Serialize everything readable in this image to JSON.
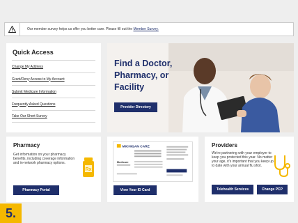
{
  "notice": {
    "message": "Our member survey helps us offer you better care. Please fill out the",
    "link": "Member Survey."
  },
  "quick_access": {
    "title": "Quick Access",
    "items": [
      "Change My Address",
      "Grant/Deny Access to My Account",
      "Submit Medicare Information",
      "Frequently Asked Questions",
      "Take Our Short Survey"
    ]
  },
  "hero": {
    "heading": "Find a Doctor, Pharmacy, or Facility",
    "button": "Provider Directory"
  },
  "pharmacy": {
    "title": "Pharmacy",
    "text": "Get information on your pharmacy benefits, including coverage information and in-network pharmacy options.",
    "button": "Pharmacy Portal",
    "icon": "pill-bottle-icon"
  },
  "id_card": {
    "brand": "MICHIGAN CARE",
    "plan_label": "Medicare",
    "button": "View Your ID Card"
  },
  "providers": {
    "title": "Providers",
    "text": "We're partnering with your employer to keep you protected this year. No matter your age, it's important that you keep up to date with your annual flu shot.",
    "button_telehealth": "Telehealth Services",
    "button_change_pcp": "Change PCP",
    "icon": "stethoscope-icon"
  },
  "step_badge": "5.",
  "colors": {
    "navy": "#1f2f6b",
    "gold": "#f5b800",
    "background": "#eeeeee"
  }
}
